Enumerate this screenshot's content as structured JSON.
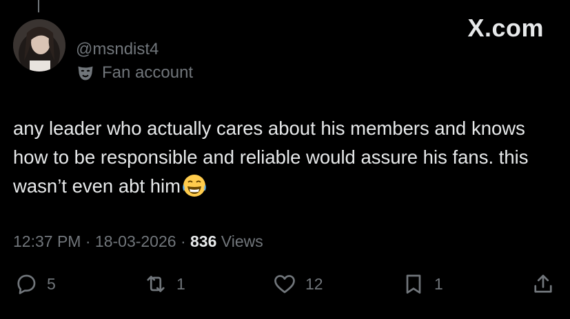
{
  "profile": {
    "handle": "@msndist4",
    "label": "Fan account"
  },
  "brand": {
    "text": "X.com"
  },
  "tweet": {
    "text": "any leader who actually cares about his members and knows how to be responsible and reliable would assure his fans. this wasn’t even abt him",
    "emoji": "face-with-tears-of-joy"
  },
  "meta": {
    "time": "12:37 PM",
    "separator": "·",
    "date": "18-03-2026",
    "views_count": "836",
    "views_label": "Views"
  },
  "actions": {
    "replies": "5",
    "reposts": "1",
    "likes": "12",
    "bookmarks": "1"
  },
  "colors": {
    "background": "#000000",
    "text": "#e7e9ea",
    "muted": "#71767b"
  }
}
